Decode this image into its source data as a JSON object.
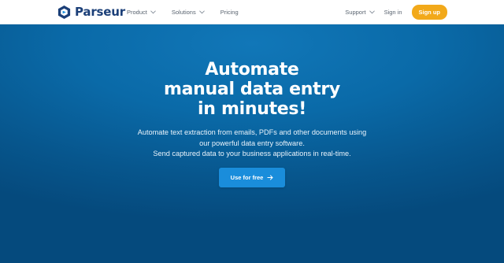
{
  "brand": {
    "name": "Parseur",
    "logo_icon": "parseur-hexagon-logo",
    "color": "#1b3f78"
  },
  "nav": {
    "items": [
      {
        "label": "Product",
        "has_dropdown": true
      },
      {
        "label": "Solutions",
        "has_dropdown": true
      },
      {
        "label": "Pricing",
        "has_dropdown": false
      }
    ],
    "support_label": "Support",
    "signin_label": "Sign in",
    "signup_label": "Sign up",
    "signup_color": "#f2a91a"
  },
  "hero": {
    "title_lines": [
      "Automate",
      "manual data entry",
      "in minutes!"
    ],
    "subtitle_lines": [
      "Automate text extraction from emails, PDFs and other documents using",
      "our powerful data entry software.",
      "Send captured data to your business applications in real-time."
    ],
    "cta_label": "Use for free",
    "cta_icon": "arrow-right-icon",
    "background_color": "#0a6aa8",
    "cta_color": "#1a8ddb"
  }
}
